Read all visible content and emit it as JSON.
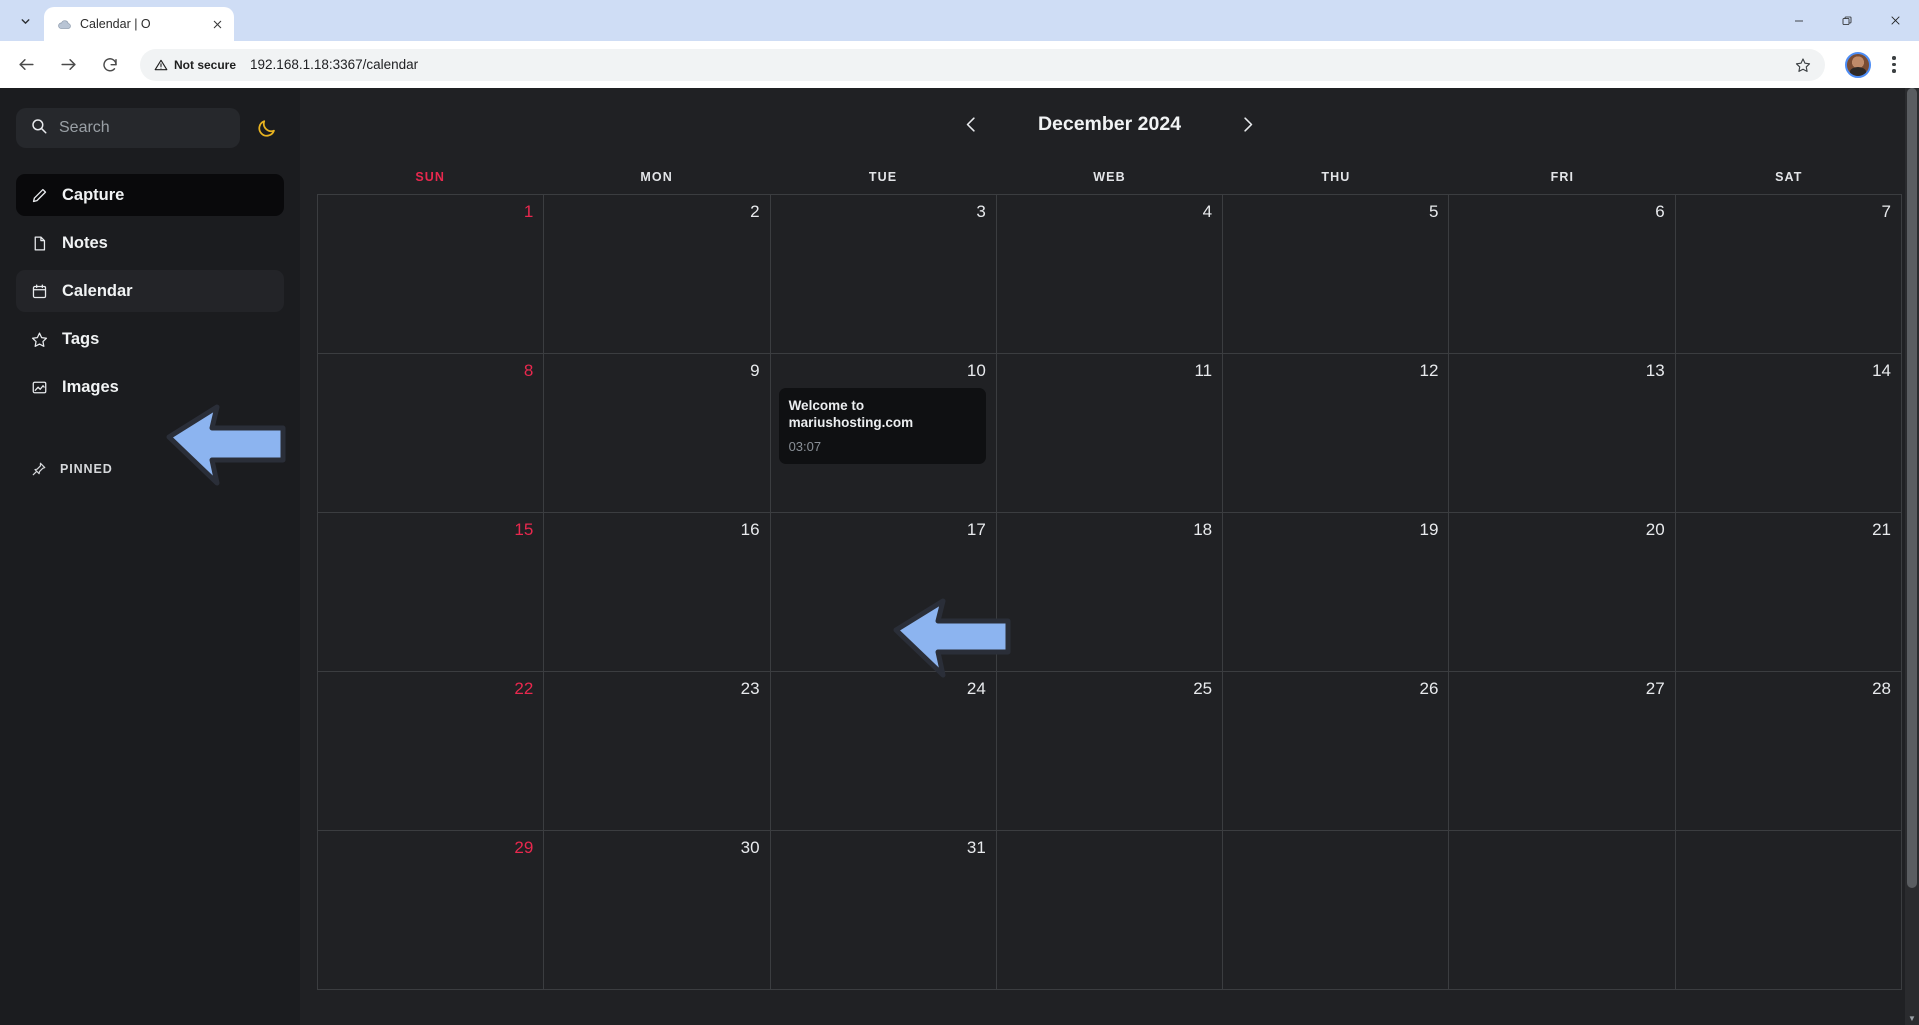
{
  "browser": {
    "tab": {
      "title": "Calendar | O",
      "favicon_icon": "cloud-favicon",
      "close_icon": "close-icon",
      "tab_search_icon": "chevron-down-icon"
    },
    "window_controls": {
      "minimize_icon": "minimize-icon",
      "restore_icon": "restore-icon",
      "close_icon": "close-icon"
    },
    "toolbar": {
      "back_icon": "back-arrow-icon",
      "forward_icon": "forward-arrow-icon",
      "reload_icon": "reload-icon",
      "security_label": "Not secure",
      "security_icon": "warning-triangle-icon",
      "url": "192.168.1.18:3367/calendar",
      "bookmark_icon": "star-icon",
      "profile_icon": "avatar",
      "menu_icon": "kebab-menu-icon"
    }
  },
  "sidebar": {
    "search": {
      "placeholder": "Search",
      "icon": "search-icon"
    },
    "theme_toggle": {
      "icon": "moon-icon",
      "color": "#e8b320"
    },
    "items": [
      {
        "label": "Capture",
        "icon": "pencil-icon",
        "state": "active"
      },
      {
        "label": "Notes",
        "icon": "document-icon",
        "state": "normal"
      },
      {
        "label": "Calendar",
        "icon": "calendar-icon",
        "state": "hover"
      },
      {
        "label": "Tags",
        "icon": "star-icon",
        "state": "normal"
      },
      {
        "label": "Images",
        "icon": "image-icon",
        "state": "normal"
      }
    ],
    "pinned": {
      "label": "PINNED",
      "icon": "pin-icon"
    }
  },
  "calendar": {
    "prev_icon": "chevron-left-icon",
    "next_icon": "chevron-right-icon",
    "title": "December 2024",
    "weekdays": [
      {
        "label": "SUN",
        "sunday": true
      },
      {
        "label": "MON",
        "sunday": false
      },
      {
        "label": "TUE",
        "sunday": false
      },
      {
        "label": "WEB",
        "sunday": false
      },
      {
        "label": "THU",
        "sunday": false
      },
      {
        "label": "FRI",
        "sunday": false
      },
      {
        "label": "SAT",
        "sunday": false
      }
    ],
    "sunday_color": "#e8284e",
    "weeks": [
      [
        {
          "day": "1",
          "sunday": true
        },
        {
          "day": "2"
        },
        {
          "day": "3"
        },
        {
          "day": "4"
        },
        {
          "day": "5"
        },
        {
          "day": "6"
        },
        {
          "day": "7"
        }
      ],
      [
        {
          "day": "8",
          "sunday": true
        },
        {
          "day": "9"
        },
        {
          "day": "10",
          "event": {
            "title": "Welcome to mariushosting.com",
            "time": "03:07"
          }
        },
        {
          "day": "11"
        },
        {
          "day": "12"
        },
        {
          "day": "13"
        },
        {
          "day": "14"
        }
      ],
      [
        {
          "day": "15",
          "sunday": true
        },
        {
          "day": "16"
        },
        {
          "day": "17"
        },
        {
          "day": "18"
        },
        {
          "day": "19"
        },
        {
          "day": "20"
        },
        {
          "day": "21"
        }
      ],
      [
        {
          "day": "22",
          "sunday": true
        },
        {
          "day": "23"
        },
        {
          "day": "24"
        },
        {
          "day": "25"
        },
        {
          "day": "26"
        },
        {
          "day": "27"
        },
        {
          "day": "28"
        }
      ],
      [
        {
          "day": "29",
          "sunday": true
        },
        {
          "day": "30"
        },
        {
          "day": "31"
        },
        {
          "day": ""
        },
        {
          "day": ""
        },
        {
          "day": ""
        },
        {
          "day": ""
        }
      ]
    ]
  },
  "annotations": {
    "arrow_color": "#8cb4f0",
    "arrows": [
      {
        "name": "arrow-pointing-to-calendar-nav-item"
      },
      {
        "name": "arrow-pointing-to-calendar-event"
      }
    ]
  }
}
